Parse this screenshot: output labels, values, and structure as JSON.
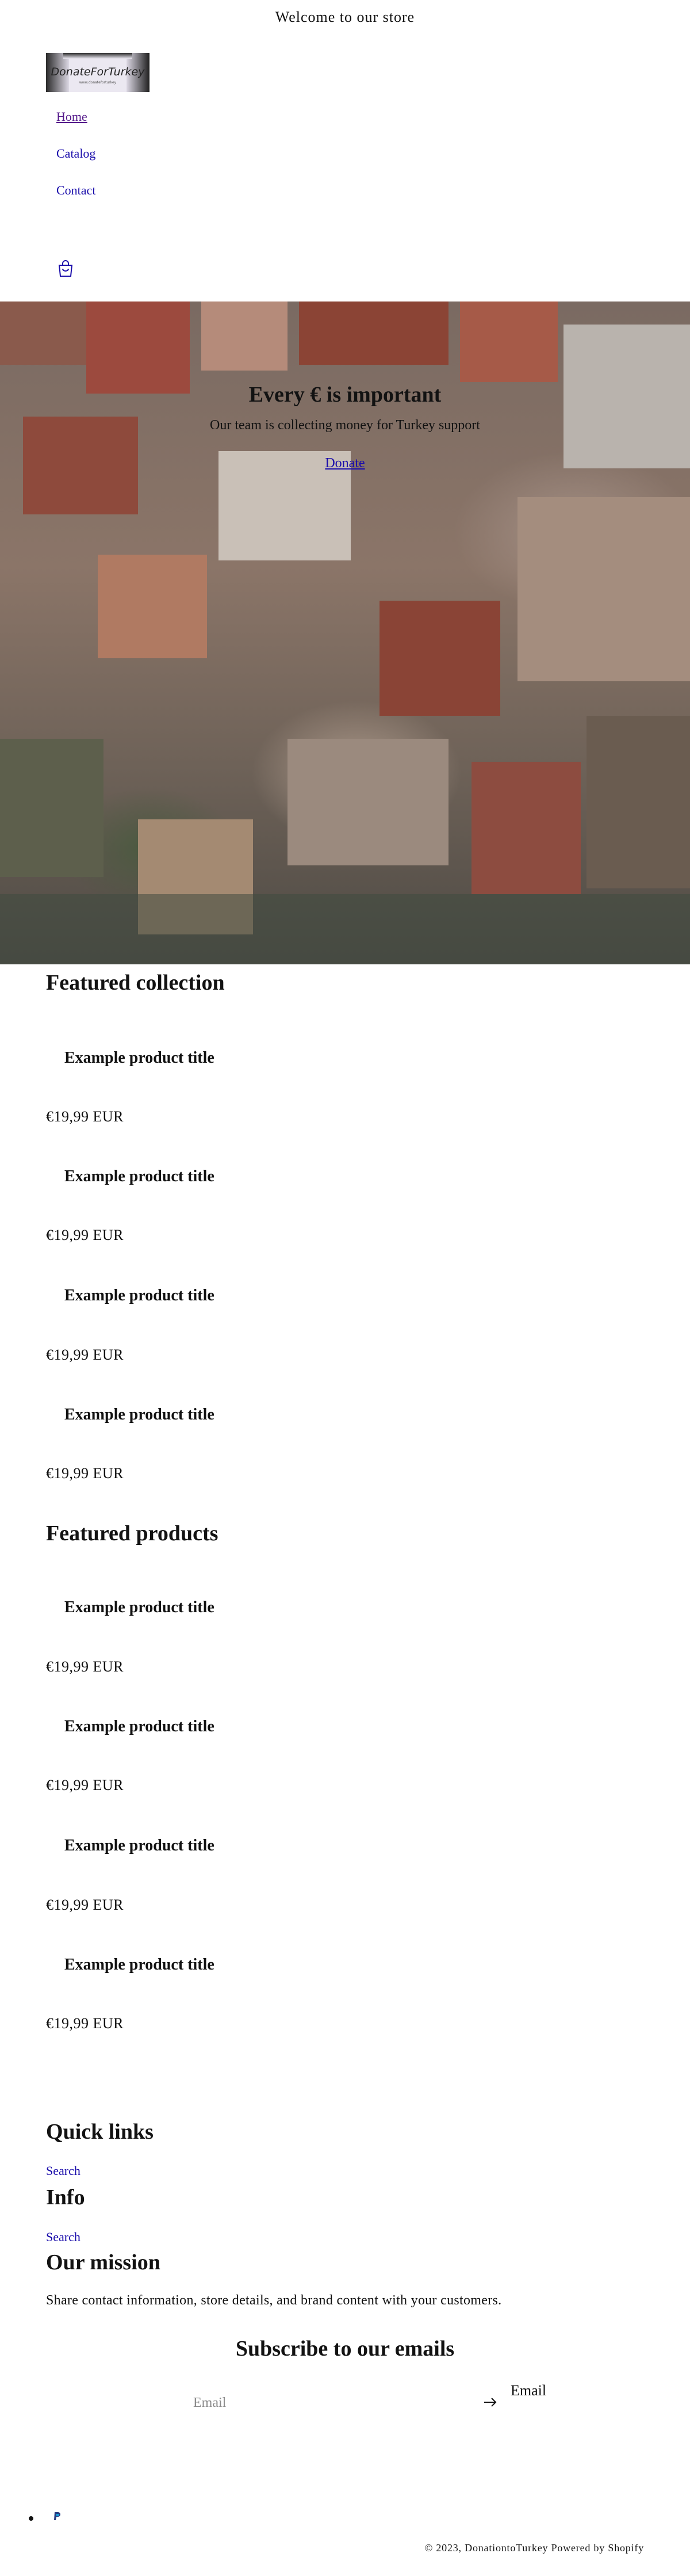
{
  "announcement": {
    "text": "Welcome to our store"
  },
  "logo": {
    "text": "DonateForTurkey",
    "subtext": "www.donateforturkey"
  },
  "nav": {
    "items": [
      "Home",
      "Catalog",
      "Contact"
    ]
  },
  "cart": {
    "icon": "cart-icon"
  },
  "hero": {
    "heading": "Every € is important",
    "subheading": "Our team is collecting money for Turkey support",
    "link": "Donate"
  },
  "featured_collection": {
    "title": "Featured collection",
    "products": [
      {
        "title": "Example product title",
        "price": "€19,99 EUR"
      },
      {
        "title": "Example product title",
        "price": "€19,99 EUR"
      },
      {
        "title": "Example product title",
        "price": "€19,99 EUR"
      },
      {
        "title": "Example product title",
        "price": "€19,99 EUR"
      }
    ]
  },
  "featured_products": {
    "title": "Featured products",
    "products": [
      {
        "title": "Example product title",
        "price": "€19,99 EUR"
      },
      {
        "title": "Example product title",
        "price": "€19,99 EUR"
      },
      {
        "title": "Example product title",
        "price": "€19,99 EUR"
      },
      {
        "title": "Example product title",
        "price": "€19,99 EUR"
      }
    ]
  },
  "footer": {
    "quick_links": {
      "title": "Quick links",
      "link": "Search"
    },
    "info": {
      "title": "Info",
      "link": "Search"
    },
    "mission": {
      "title": "Our mission",
      "text": "Share contact information, store details, and brand content with your customers."
    },
    "newsletter": {
      "title": "Subscribe to our emails",
      "placeholder": "Email",
      "label": "Email"
    },
    "copyright": {
      "year": "© 2023,",
      "store": "DonationtoTurkey",
      "powered": "Powered by Shopify"
    }
  },
  "icons": {
    "payment": "paypal-icon",
    "submit": "arrow-right-icon"
  }
}
